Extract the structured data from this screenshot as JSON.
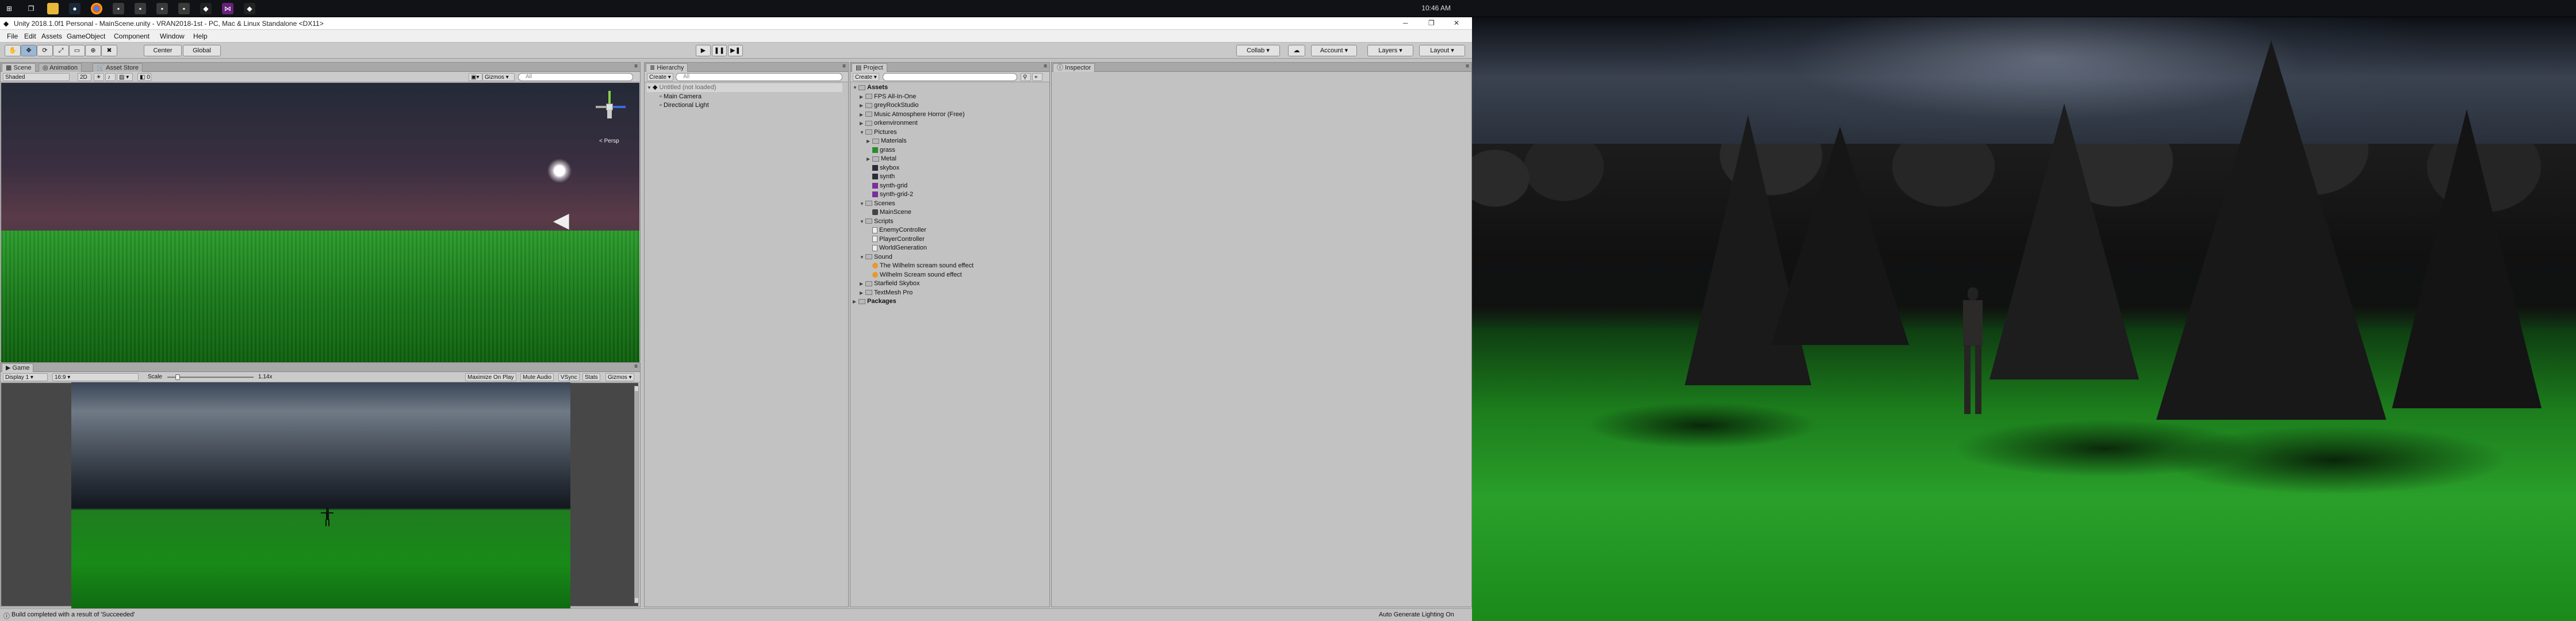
{
  "taskbar": {
    "clock": "10:46 AM",
    "icons": [
      "windows-start-icon",
      "task-view-icon",
      "file-explorer-icon",
      "steam-icon",
      "chrome-icon",
      "app-icon",
      "app-icon",
      "app-icon",
      "app-icon",
      "unity-icon",
      "visual-studio-icon",
      "unity-icon"
    ]
  },
  "window": {
    "title": "Unity 2018.1.0f1 Personal - MainScene.unity - VRAN2018-1st - PC, Mac & Linux Standalone <DX11>",
    "min": "─",
    "max": "❐",
    "close": "✕"
  },
  "menu": [
    "File",
    "Edit",
    "Assets",
    "GameObject",
    "Component",
    "Window",
    "Help"
  ],
  "toolbar": {
    "center": "Center",
    "global": "Global",
    "collab": "Collab ▾",
    "account": "Account ▾",
    "layers": "Layers ▾",
    "layout": "Layout ▾"
  },
  "scene": {
    "tabs": [
      "Scene",
      "Animation",
      "Asset Store"
    ],
    "shading": "Shaded",
    "mode_2d": "2D",
    "gizmos": "Gizmos ▾",
    "search": "All",
    "persp": "< Persp"
  },
  "game": {
    "tab": "Game",
    "display": "Display 1",
    "aspect": "16:9",
    "scale_label": "Scale",
    "scale_value": "1.14x",
    "buttons": [
      "Maximize On Play",
      "Mute Audio",
      "VSync",
      "Stats",
      "Gizmos ▾"
    ]
  },
  "hierarchy": {
    "tab": "Hierarchy",
    "create": "Create ▾",
    "search": "All",
    "scene_name": "Untitled (not loaded)",
    "items": [
      "Main Camera",
      "Directional Light"
    ]
  },
  "project": {
    "tab": "Project",
    "create": "Create ▾",
    "tree": [
      {
        "label": "Assets",
        "depth": 0,
        "bold": true,
        "expanded": true,
        "icon": "folder"
      },
      {
        "label": "FPS All-In-One",
        "depth": 1,
        "icon": "folder"
      },
      {
        "label": "greyRockStudio",
        "depth": 1,
        "icon": "folder"
      },
      {
        "label": "Music Atmosphere Horror (Free)",
        "depth": 1,
        "icon": "folder"
      },
      {
        "label": "orkenvironment",
        "depth": 1,
        "icon": "folder"
      },
      {
        "label": "Pictures",
        "depth": 1,
        "expanded": true,
        "icon": "folder"
      },
      {
        "label": "Materials",
        "depth": 2,
        "icon": "folder"
      },
      {
        "label": "grass",
        "depth": 2,
        "icon": "green"
      },
      {
        "label": "Metal",
        "depth": 2,
        "icon": "folder"
      },
      {
        "label": "skybox",
        "depth": 2,
        "icon": "dark"
      },
      {
        "label": "synth",
        "depth": 2,
        "icon": "dark"
      },
      {
        "label": "synth-grid",
        "depth": 2,
        "icon": "purple"
      },
      {
        "label": "synth-grid-2",
        "depth": 2,
        "icon": "purple"
      },
      {
        "label": "Scenes",
        "depth": 1,
        "expanded": true,
        "icon": "folder"
      },
      {
        "label": "MainScene",
        "depth": 2,
        "icon": "unity"
      },
      {
        "label": "Scripts",
        "depth": 1,
        "expanded": true,
        "icon": "folder"
      },
      {
        "label": "EnemyController",
        "depth": 2,
        "icon": "script"
      },
      {
        "label": "PlayerController",
        "depth": 2,
        "icon": "script"
      },
      {
        "label": "WorldGeneration",
        "depth": 2,
        "icon": "script"
      },
      {
        "label": "Sound",
        "depth": 1,
        "expanded": true,
        "icon": "folder"
      },
      {
        "label": "The Wilhelm scream sound effect",
        "depth": 2,
        "icon": "audio"
      },
      {
        "label": "Wilhelm Scream sound effect",
        "depth": 2,
        "icon": "audio"
      },
      {
        "label": "Starfield Skybox",
        "depth": 1,
        "icon": "folder"
      },
      {
        "label": "TextMesh Pro",
        "depth": 1,
        "icon": "folder"
      },
      {
        "label": "Packages",
        "depth": 0,
        "bold": true,
        "icon": "folder"
      }
    ]
  },
  "inspector": {
    "tab": "Inspector"
  },
  "status": {
    "message": "Build completed with a result of 'Succeeded'",
    "lighting": "Auto Generate Lighting On"
  }
}
